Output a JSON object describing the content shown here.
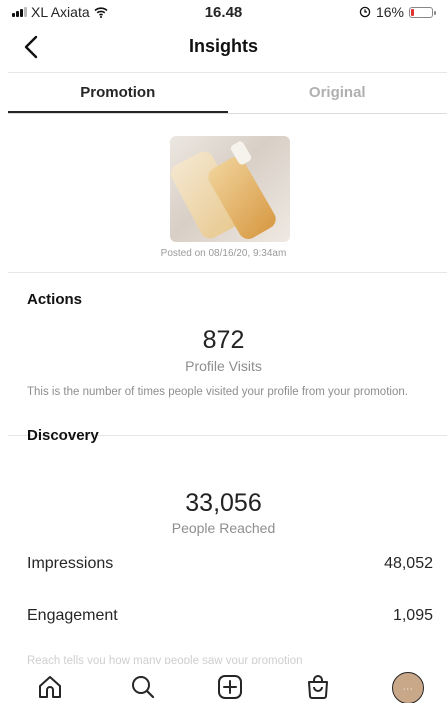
{
  "status_bar": {
    "carrier": "XL Axiata",
    "time": "16.48",
    "battery": "16%",
    "battery_level": 0.16,
    "battery_color": "#e0342f"
  },
  "nav": {
    "back_icon": "chevron-left-icon",
    "title": "Insights"
  },
  "tabs": [
    {
      "label": "Promotion",
      "active": true
    },
    {
      "label": "Original",
      "active": false
    }
  ],
  "post": {
    "posted_text": "Posted on 08/16/20, 9:34am"
  },
  "actions": {
    "title": "Actions",
    "value": "872",
    "label": "Profile Visits",
    "description": "This is the number of times people visited your profile from your promotion."
  },
  "discovery": {
    "title": "Discovery",
    "value": "33,056",
    "label": "People Reached",
    "rows": [
      {
        "label": "Impressions",
        "value": "48,052"
      },
      {
        "label": "Engagement",
        "value": "1,095"
      }
    ],
    "partial_text": "Reach tells you how many people saw your promotion"
  },
  "tabbar": {
    "items": [
      "home-icon",
      "search-icon",
      "new-post-icon",
      "shop-icon",
      "profile-avatar"
    ]
  }
}
